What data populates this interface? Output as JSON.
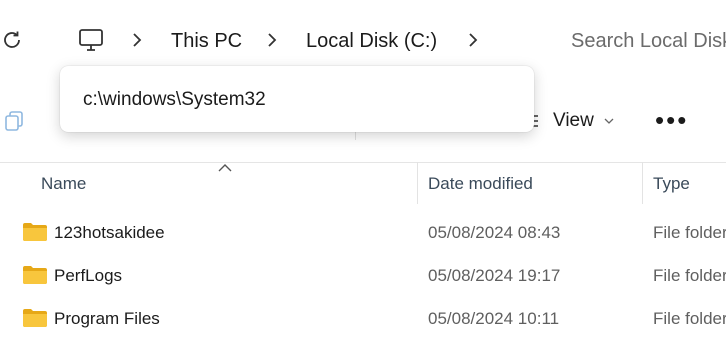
{
  "address": {
    "breadcrumbs": [
      "This PC",
      "Local Disk (C:)"
    ],
    "search_placeholder": "Search Local Disk"
  },
  "popup": {
    "path_text": "c:\\windows\\System32"
  },
  "toolbar": {
    "view_label": "View",
    "more_label": "•••"
  },
  "columns": {
    "name": "Name",
    "date_modified": "Date modified",
    "type": "Type"
  },
  "rows": [
    {
      "name": "123hotsakidee",
      "date": "05/08/2024 08:43",
      "type": "File folder"
    },
    {
      "name": "PerfLogs",
      "date": "05/08/2024 19:17",
      "type": "File folder"
    },
    {
      "name": "Program Files",
      "date": "05/08/2024 10:11",
      "type": "File folder"
    }
  ],
  "colors": {
    "folder": "#f8c63d",
    "folder_dark": "#e6a817",
    "accent": "#0067c0"
  }
}
